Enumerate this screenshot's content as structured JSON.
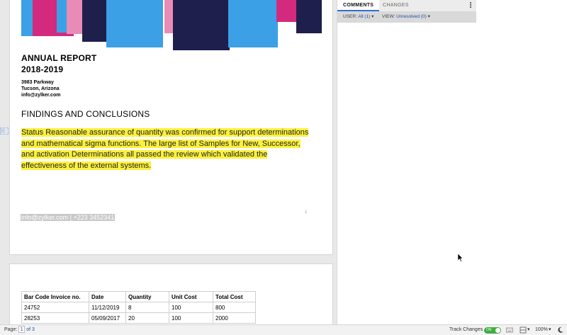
{
  "document": {
    "report_title_line1": "ANNUAL REPORT",
    "report_title_line2": "2018-2019",
    "address_line1": "3983 Parkway",
    "address_line2": "Tucson, Arizona",
    "email": "info@zylker.com",
    "section_heading": "FINDINGS AND CONCLUSIONS",
    "paragraph": "Status Reasonable assurance of quantity was confirmed for support determinations and mathematical sigma functions. The large list of Samples for New, Successor, and activation Determinations all passed the review which validated the effectiveness of the external systems.",
    "footer_contact": "info@zylker.com | +223 3452341",
    "page_number": "1",
    "highlight_color": "#fbf13d",
    "table": {
      "headers": [
        "Bar Code Invoice no.",
        "Date",
        "Quantity",
        "Unit Cost",
        "Total Cost"
      ],
      "rows": [
        [
          "24752",
          "11/12/2019",
          "8",
          "100",
          "800"
        ],
        [
          "28253",
          "05/09/2017",
          "20",
          "100",
          "2000"
        ]
      ]
    }
  },
  "panel": {
    "tabs": [
      "COMMENTS",
      "CHANGES"
    ],
    "active_tab": "COMMENTS",
    "user_label": "USER:",
    "user_value": "All (1)",
    "view_label": "VIEW:",
    "view_value": "Unresolved (0)"
  },
  "status_bar": {
    "page_label": "Page:",
    "current_page": "1",
    "of_pages": "of 3",
    "track_changes_label": "Track Changes",
    "track_changes_state": "ON",
    "zoom": "100%"
  },
  "colors": {
    "accent": "#2f6fd6",
    "toggle_on": "#3fae3f",
    "banner_blue": "#3ba0e6",
    "banner_pink": "#d32a7d",
    "banner_navy": "#1f1f4d",
    "banner_light_pink": "#e88cb6"
  }
}
